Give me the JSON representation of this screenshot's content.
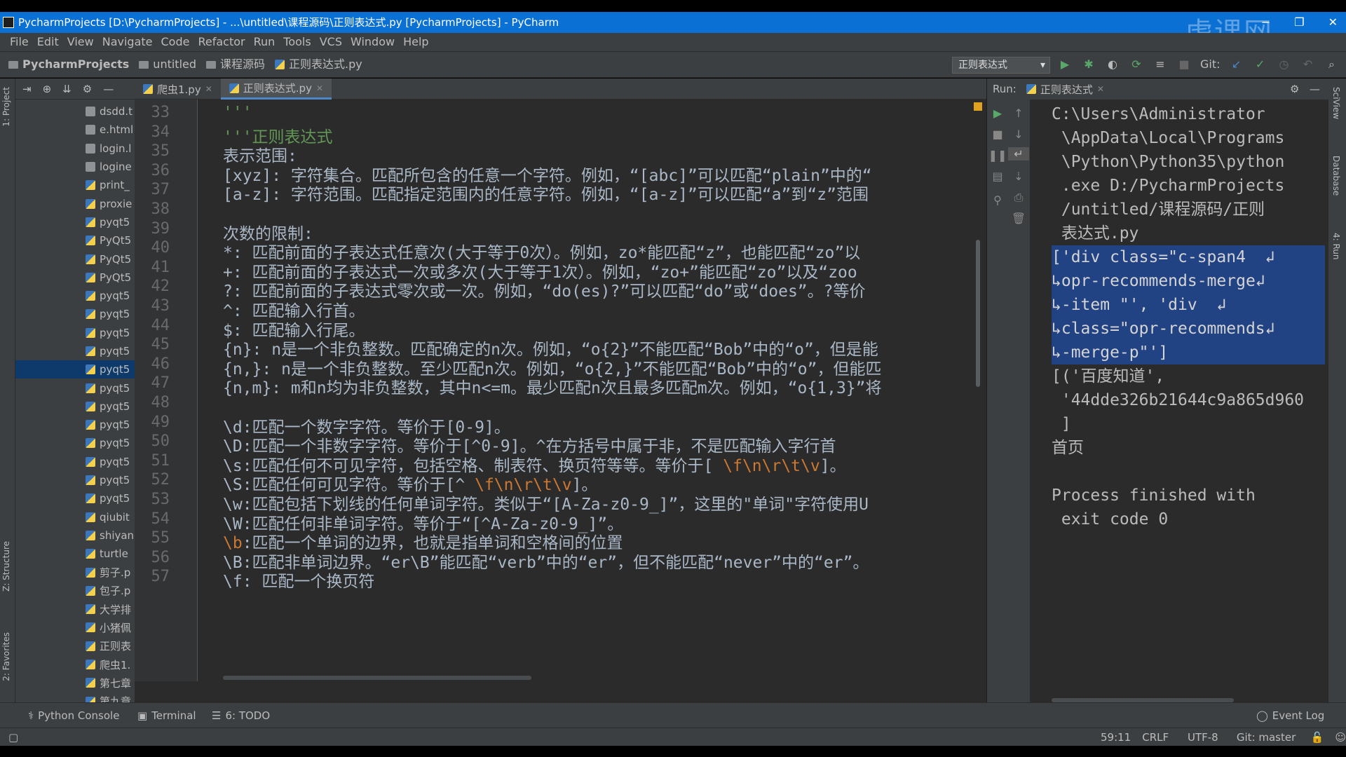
{
  "window": {
    "title": "PycharmProjects [D:\\PycharmProjects] - ...\\untitled\\课程源码\\正则表达式.py [PycharmProjects] - PyCharm",
    "controls": [
      "−",
      "❐",
      "✕"
    ],
    "watermark": "虎课网"
  },
  "menu": [
    "File",
    "Edit",
    "View",
    "Navigate",
    "Code",
    "Refactor",
    "Run",
    "Tools",
    "VCS",
    "Window",
    "Help"
  ],
  "breadcrumb": [
    "PycharmProjects",
    "untitled",
    "课程源码",
    "正则表达式.py"
  ],
  "run_config": "正则表达式",
  "git_label": "Git:",
  "project_files": [
    "dsdd.t",
    "e.html",
    "login.l",
    "logine",
    "print_",
    "proxie",
    "pyqt5",
    "PyQt5",
    "PyQt5",
    "PyQt5",
    "pyqt5",
    "pyqt5",
    "pyqt5",
    "pyqt5",
    "pyqt5",
    "pyqt5",
    "pyqt5",
    "pyqt5",
    "pyqt5",
    "pyqt5",
    "pyqt5",
    "pyqt5",
    "qiubit",
    "shiyan",
    "turtle",
    "剪子.p",
    "包子.p",
    "大学排",
    "小猪佩",
    "正则表",
    "爬虫1.",
    "第七章",
    "第九章"
  ],
  "editor_tabs": [
    {
      "label": "爬虫1.py",
      "active": false
    },
    {
      "label": "正则表达式.py",
      "active": true
    }
  ],
  "code_lines": [
    {
      "n": "33",
      "text": "'''"
    },
    {
      "n": "34",
      "text": "'''正则表达式"
    },
    {
      "n": "35",
      "text": "表示范围:"
    },
    {
      "n": "36",
      "text": "[xyz]: 字符集合。匹配所包含的任意一个字符。例如，“[abc]”可以匹配“plain”中的“"
    },
    {
      "n": "37",
      "text": "[a-z]: 字符范围。匹配指定范围内的任意字符。例如，“[a-z]”可以匹配“a”到“z”范围"
    },
    {
      "n": "38",
      "text": ""
    },
    {
      "n": "39",
      "text": "次数的限制:"
    },
    {
      "n": "40",
      "text": "*: 匹配前面的子表达式任意次(大于等于0次）。例如，zo*能匹配“z”，也能匹配“zo”以"
    },
    {
      "n": "41",
      "text": "+: 匹配前面的子表达式一次或多次(大于等于1次）。例如，“zo+”能匹配“zo”以及“zoo"
    },
    {
      "n": "42",
      "text": "?: 匹配前面的子表达式零次或一次。例如，“do(es)?”可以匹配“do”或“does”。?等价"
    },
    {
      "n": "43",
      "text": "^: 匹配输入行首。"
    },
    {
      "n": "44",
      "text": "$: 匹配输入行尾。"
    },
    {
      "n": "45",
      "text": "{n}: n是一个非负整数。匹配确定的n次。例如，“o{2}”不能匹配“Bob”中的“o”，但是能"
    },
    {
      "n": "46",
      "text": "{n,}: n是一个非负整数。至少匹配n次。例如，“o{2,}”不能匹配“Bob”中的“o”，但能匹"
    },
    {
      "n": "47",
      "text": "{n,m}: m和n均为非负整数，其中n<=m。最少匹配n次且最多匹配m次。例如，“o{1,3}”将"
    },
    {
      "n": "48",
      "text": ""
    },
    {
      "n": "49",
      "text": "\\d:匹配一个数字字符。等价于[0-9]。"
    },
    {
      "n": "50",
      "text": "\\D:匹配一个非数字字符。等价于[^0-9]。^在方括号中属于非，不是匹配输入字行首"
    },
    {
      "n": "51",
      "text": "\\s:匹配任何不可见字符，包括空格、制表符、换页符等等。等价于[ ",
      "esc": "\\f\\n\\r\\t\\v",
      "tail": "]。"
    },
    {
      "n": "52",
      "text": "\\S:匹配任何可见字符。等价于[^ ",
      "esc": "\\f\\n\\r\\t\\v",
      "tail": "]。"
    },
    {
      "n": "53",
      "text": "\\w:匹配包括下划线的任何单词字符。类似于“[A-Za-z0-9_]”，这里的\"单词\"字符使用U"
    },
    {
      "n": "54",
      "text": "\\W:匹配任何非单词字符。等价于“[^A-Za-z0-9_]”。"
    },
    {
      "n": "55",
      "text": "",
      "esc": "\\b",
      "tail": ":匹配一个单词的边界，也就是指单词和空格间的位置"
    },
    {
      "n": "56",
      "text": "\\B:匹配非单词边界。“er\\B”能匹配“verb”中的“er”，但不能匹配“never”中的“er”。"
    },
    {
      "n": "57",
      "text": "\\f: 匹配一个换页符"
    }
  ],
  "run_panel": {
    "label": "Run:",
    "tab": "正则表达式",
    "console_lines": [
      {
        "text": "C:\\Users\\Administrator",
        "sel": false
      },
      {
        "text": " \\AppData\\Local\\Programs",
        "sel": false
      },
      {
        "text": " \\Python\\Python35\\python",
        "sel": false
      },
      {
        "text": " .exe D:/PycharmProjects",
        "sel": false
      },
      {
        "text": " /untitled/课程源码/正则",
        "sel": false
      },
      {
        "text": " 表达式.py",
        "sel": false
      },
      {
        "text": "['div class=\"c-span4  ↲",
        "sel": true
      },
      {
        "text": "↳opr-recommends-merge↲",
        "sel": true
      },
      {
        "text": "↳-item \"', 'div  ↲",
        "sel": true
      },
      {
        "text": "↳class=\"opr-recommends↲",
        "sel": true
      },
      {
        "text": "↳-merge-p\"']",
        "sel": true
      },
      {
        "text": "[('百度知道',",
        "sel": false
      },
      {
        "text": " '44dde326b21644c9a865d960",
        "sel": false
      },
      {
        "text": " ]",
        "sel": false
      },
      {
        "text": "首页",
        "sel": false
      },
      {
        "text": "",
        "sel": false
      },
      {
        "text": "Process finished with",
        "sel": false
      },
      {
        "text": " exit code 0",
        "sel": false
      }
    ]
  },
  "left_strip_tabs": [
    "1: Project",
    "Z: Structure",
    "2: Favorites"
  ],
  "right_strip_tabs": [
    "SciView",
    "Database",
    "4: Run"
  ],
  "bottom_tabs": [
    "Python Console",
    "Terminal",
    "6: TODO"
  ],
  "event_log": "Event Log",
  "status": {
    "position": "59:11",
    "line_sep": "CRLF ÷",
    "encoding": "UTF-8 ÷",
    "git_branch": "Git: master ÷"
  }
}
